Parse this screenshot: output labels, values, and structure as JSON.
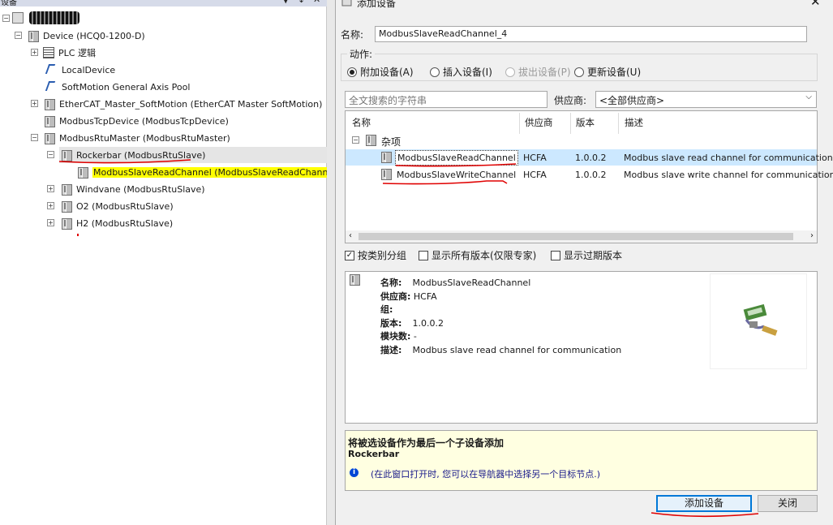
{
  "left_panel": {
    "title": "设备",
    "btn_down": "▼",
    "btn_pin": "↕",
    "btn_close": "✕",
    "tree": {
      "device": "Device (HCQ0-1200-D)",
      "plc_logic": "PLC 逻辑",
      "local_device": "LocalDevice",
      "softmotion_pool": "SoftMotion General Axis Pool",
      "ethercat_master": "EtherCAT_Master_SoftMotion (EtherCAT Master SoftMotion)",
      "modbus_tcp": "ModbusTcpDevice (ModbusTcpDevice)",
      "modbus_rtu_master": "ModbusRtuMaster (ModbusRtuMaster)",
      "rockerbar": "Rockerbar (ModbusRtuSlave)",
      "read_channel_child": "ModbusSlaveReadChannel (ModbusSlaveReadChannel)",
      "windvane": "Windvane (ModbusRtuSlave)",
      "o2": "O2 (ModbusRtuSlave)",
      "h2": "H2 (ModbusRtuSlave)"
    }
  },
  "dialog": {
    "title": "添加设备",
    "close": "✕",
    "name_label": "名称:",
    "name_value": "ModbusSlaveReadChannel_4",
    "action_label": "动作:",
    "actions": {
      "append": "附加设备(A)",
      "insert": "插入设备(I)",
      "plug": "拔出设备(P)",
      "update": "更新设备(U)"
    },
    "search_placeholder": "全文搜索的字符串",
    "vendor_label": "供应商:",
    "vendor_value": "<全部供应商>",
    "list": {
      "col_name": "名称",
      "col_vendor": "供应商",
      "col_version": "版本",
      "col_desc": "描述",
      "group": "杂项",
      "rows": [
        {
          "name": "ModbusSlaveReadChannel",
          "vendor": "HCFA",
          "version": "1.0.0.2",
          "desc": "Modbus slave read channel for communication"
        },
        {
          "name": "ModbusSlaveWriteChannel",
          "vendor": "HCFA",
          "version": "1.0.0.2",
          "desc": "Modbus slave write channel for communication"
        }
      ]
    },
    "checks": {
      "group_by_category": "按类别分组",
      "show_all_versions": "显示所有版本(仅限专家)",
      "show_outdated": "显示过期版本"
    },
    "info": {
      "name_k": "名称:",
      "name_v": "ModbusSlaveReadChannel",
      "vendor_k": "供应商:",
      "vendor_v": "HCFA",
      "group_k": "组:",
      "version_k": "版本:",
      "version_v": "1.0.0.2",
      "modules_k": "模块数:",
      "modules_v": "-",
      "desc_k": "描述:",
      "desc_v": "Modbus slave read channel for communication"
    },
    "hint": {
      "line1": "将被选设备作为最后一个子设备添加",
      "line2": "Rockerbar",
      "info_text": "(在此窗口打开时, 您可以在导航器中选择另一个目标节点.)"
    },
    "add_button": "添加设备",
    "close_button": "关闭"
  },
  "colors": {
    "selection": "#cce8ff",
    "highlight": "#ffff00",
    "annotation": "#e00000",
    "hint_bg": "#ffffe1",
    "info_icon": "#0046d5"
  }
}
